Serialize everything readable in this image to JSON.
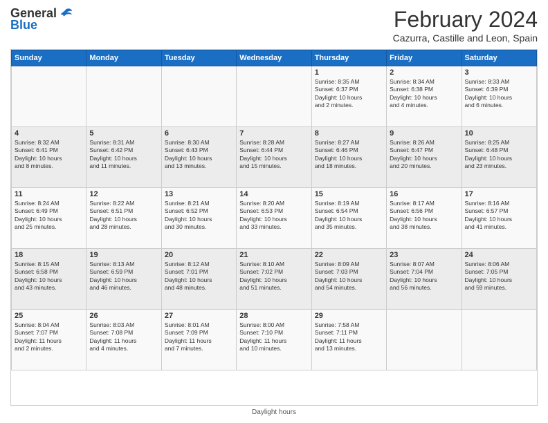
{
  "header": {
    "logo_line1": "General",
    "logo_line2": "Blue",
    "title": "February 2024",
    "subtitle": "Cazurra, Castille and Leon, Spain"
  },
  "days_of_week": [
    "Sunday",
    "Monday",
    "Tuesday",
    "Wednesday",
    "Thursday",
    "Friday",
    "Saturday"
  ],
  "weeks": [
    [
      {
        "day": "",
        "info": ""
      },
      {
        "day": "",
        "info": ""
      },
      {
        "day": "",
        "info": ""
      },
      {
        "day": "",
        "info": ""
      },
      {
        "day": "1",
        "info": "Sunrise: 8:35 AM\nSunset: 6:37 PM\nDaylight: 10 hours\nand 2 minutes."
      },
      {
        "day": "2",
        "info": "Sunrise: 8:34 AM\nSunset: 6:38 PM\nDaylight: 10 hours\nand 4 minutes."
      },
      {
        "day": "3",
        "info": "Sunrise: 8:33 AM\nSunset: 6:39 PM\nDaylight: 10 hours\nand 6 minutes."
      }
    ],
    [
      {
        "day": "4",
        "info": "Sunrise: 8:32 AM\nSunset: 6:41 PM\nDaylight: 10 hours\nand 8 minutes."
      },
      {
        "day": "5",
        "info": "Sunrise: 8:31 AM\nSunset: 6:42 PM\nDaylight: 10 hours\nand 11 minutes."
      },
      {
        "day": "6",
        "info": "Sunrise: 8:30 AM\nSunset: 6:43 PM\nDaylight: 10 hours\nand 13 minutes."
      },
      {
        "day": "7",
        "info": "Sunrise: 8:28 AM\nSunset: 6:44 PM\nDaylight: 10 hours\nand 15 minutes."
      },
      {
        "day": "8",
        "info": "Sunrise: 8:27 AM\nSunset: 6:46 PM\nDaylight: 10 hours\nand 18 minutes."
      },
      {
        "day": "9",
        "info": "Sunrise: 8:26 AM\nSunset: 6:47 PM\nDaylight: 10 hours\nand 20 minutes."
      },
      {
        "day": "10",
        "info": "Sunrise: 8:25 AM\nSunset: 6:48 PM\nDaylight: 10 hours\nand 23 minutes."
      }
    ],
    [
      {
        "day": "11",
        "info": "Sunrise: 8:24 AM\nSunset: 6:49 PM\nDaylight: 10 hours\nand 25 minutes."
      },
      {
        "day": "12",
        "info": "Sunrise: 8:22 AM\nSunset: 6:51 PM\nDaylight: 10 hours\nand 28 minutes."
      },
      {
        "day": "13",
        "info": "Sunrise: 8:21 AM\nSunset: 6:52 PM\nDaylight: 10 hours\nand 30 minutes."
      },
      {
        "day": "14",
        "info": "Sunrise: 8:20 AM\nSunset: 6:53 PM\nDaylight: 10 hours\nand 33 minutes."
      },
      {
        "day": "15",
        "info": "Sunrise: 8:19 AM\nSunset: 6:54 PM\nDaylight: 10 hours\nand 35 minutes."
      },
      {
        "day": "16",
        "info": "Sunrise: 8:17 AM\nSunset: 6:56 PM\nDaylight: 10 hours\nand 38 minutes."
      },
      {
        "day": "17",
        "info": "Sunrise: 8:16 AM\nSunset: 6:57 PM\nDaylight: 10 hours\nand 41 minutes."
      }
    ],
    [
      {
        "day": "18",
        "info": "Sunrise: 8:15 AM\nSunset: 6:58 PM\nDaylight: 10 hours\nand 43 minutes."
      },
      {
        "day": "19",
        "info": "Sunrise: 8:13 AM\nSunset: 6:59 PM\nDaylight: 10 hours\nand 46 minutes."
      },
      {
        "day": "20",
        "info": "Sunrise: 8:12 AM\nSunset: 7:01 PM\nDaylight: 10 hours\nand 48 minutes."
      },
      {
        "day": "21",
        "info": "Sunrise: 8:10 AM\nSunset: 7:02 PM\nDaylight: 10 hours\nand 51 minutes."
      },
      {
        "day": "22",
        "info": "Sunrise: 8:09 AM\nSunset: 7:03 PM\nDaylight: 10 hours\nand 54 minutes."
      },
      {
        "day": "23",
        "info": "Sunrise: 8:07 AM\nSunset: 7:04 PM\nDaylight: 10 hours\nand 56 minutes."
      },
      {
        "day": "24",
        "info": "Sunrise: 8:06 AM\nSunset: 7:05 PM\nDaylight: 10 hours\nand 59 minutes."
      }
    ],
    [
      {
        "day": "25",
        "info": "Sunrise: 8:04 AM\nSunset: 7:07 PM\nDaylight: 11 hours\nand 2 minutes."
      },
      {
        "day": "26",
        "info": "Sunrise: 8:03 AM\nSunset: 7:08 PM\nDaylight: 11 hours\nand 4 minutes."
      },
      {
        "day": "27",
        "info": "Sunrise: 8:01 AM\nSunset: 7:09 PM\nDaylight: 11 hours\nand 7 minutes."
      },
      {
        "day": "28",
        "info": "Sunrise: 8:00 AM\nSunset: 7:10 PM\nDaylight: 11 hours\nand 10 minutes."
      },
      {
        "day": "29",
        "info": "Sunrise: 7:58 AM\nSunset: 7:11 PM\nDaylight: 11 hours\nand 13 minutes."
      },
      {
        "day": "",
        "info": ""
      },
      {
        "day": "",
        "info": ""
      }
    ]
  ],
  "footer": "Daylight hours"
}
